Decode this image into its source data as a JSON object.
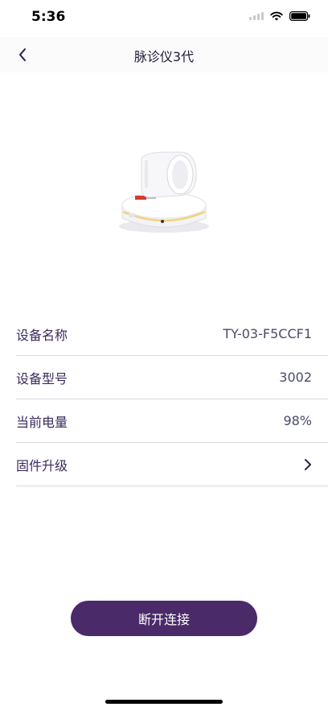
{
  "status_bar": {
    "time": "5:36"
  },
  "nav": {
    "title": "脉诊仪3代"
  },
  "device": {
    "image_icon": "pulse-diagnostic-device",
    "info": [
      {
        "label": "设备名称",
        "value": "TY-03-F5CCF1"
      },
      {
        "label": "设备型号",
        "value": "3002"
      },
      {
        "label": "当前电量",
        "value": "98%"
      },
      {
        "label": "固件升级",
        "value": ""
      }
    ]
  },
  "actions": {
    "disconnect_label": "断开连接"
  },
  "colors": {
    "primary": "#4b2a6a",
    "label_text": "#3b2a5e",
    "divider": "#d9d9de"
  }
}
